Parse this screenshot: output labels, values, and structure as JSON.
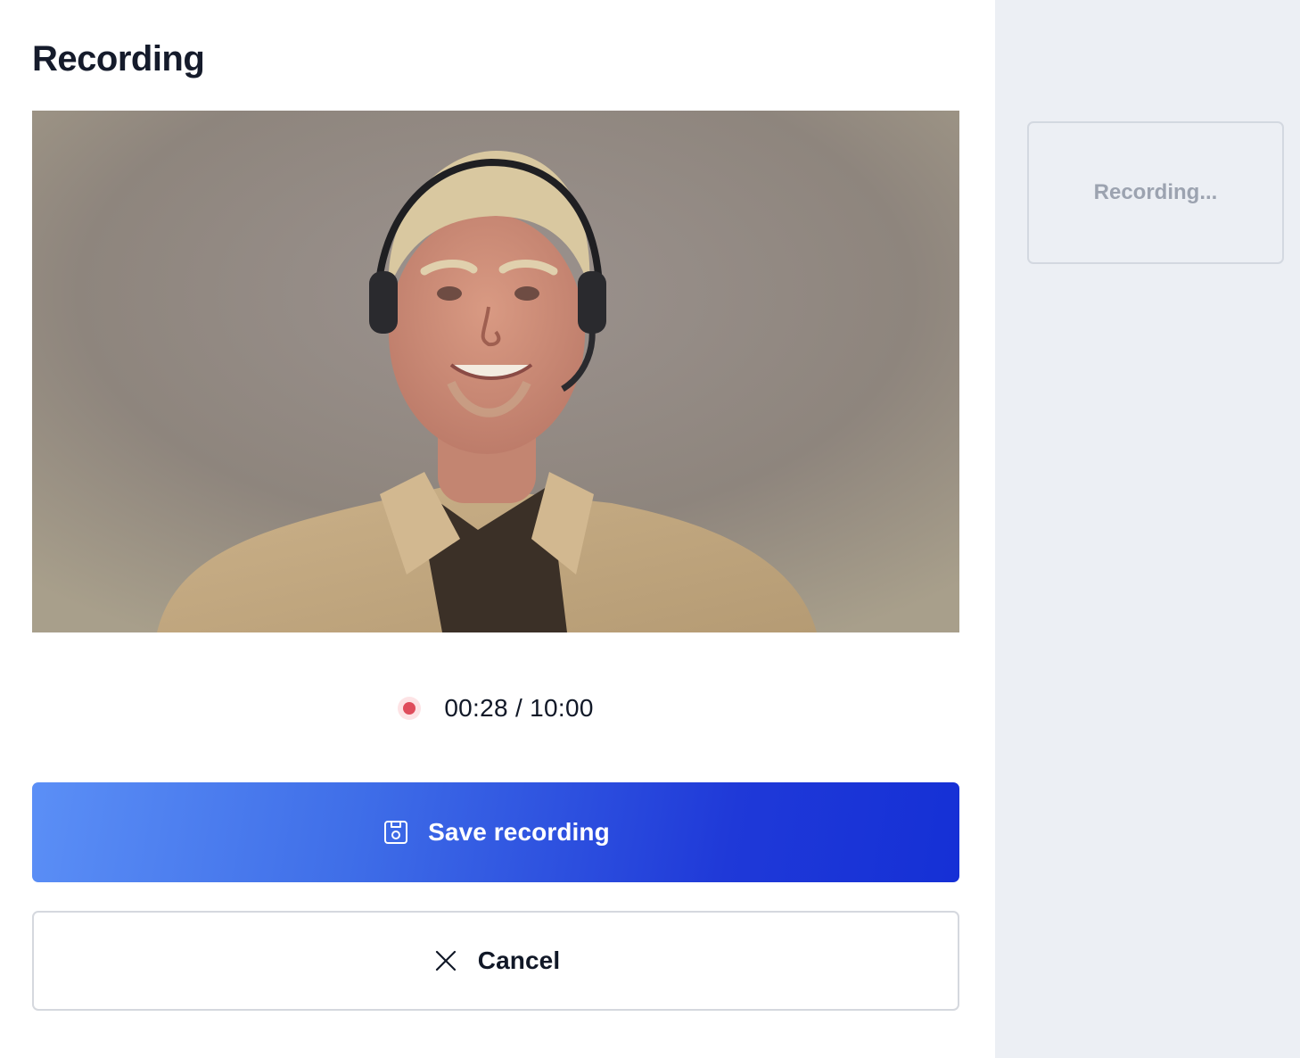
{
  "page": {
    "title": "Recording"
  },
  "video_preview": {
    "icon": "webcam-preview"
  },
  "timer": {
    "indicator_icon": "record-dot-icon",
    "text": "00:28 / 10:00",
    "elapsed": "00:28",
    "limit": "10:00",
    "indicator_color": "#df4d5c"
  },
  "actions": {
    "save": {
      "label": "Save recording",
      "icon": "save-icon",
      "color_start": "#5b8ff6",
      "color_end": "#1530d6"
    },
    "cancel": {
      "label": "Cancel",
      "icon": "close-icon"
    }
  },
  "sidebar": {
    "background": "#eceff4",
    "status_card": {
      "label": "Recording..."
    }
  }
}
